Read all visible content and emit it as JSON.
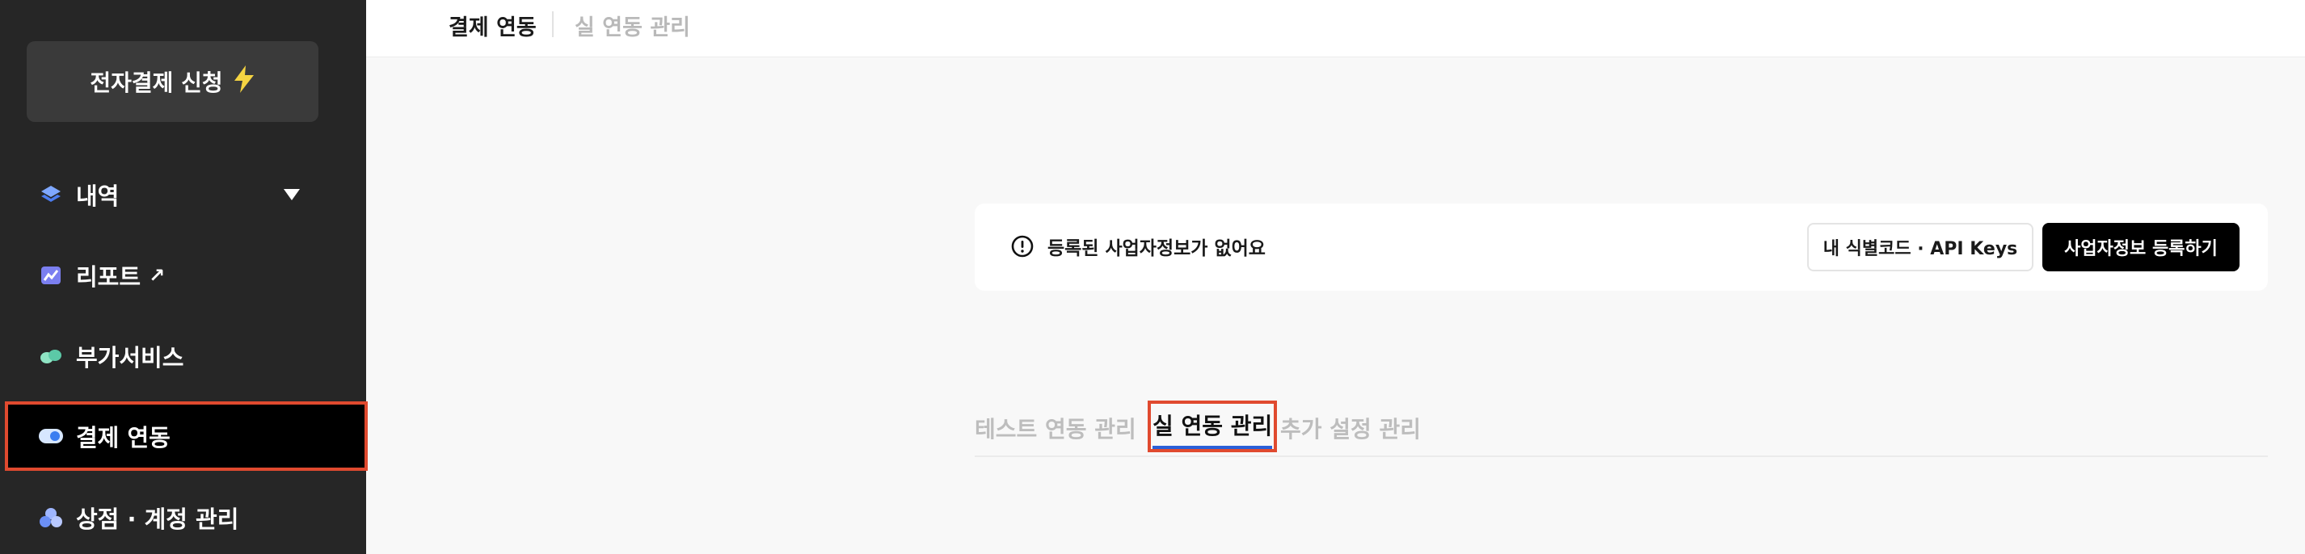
{
  "sidebar": {
    "apply_button": "전자결제 신청",
    "items": [
      {
        "label": "내역",
        "icon": "layers-icon"
      },
      {
        "label": "리포트",
        "icon": "chart-icon"
      },
      {
        "label": "부가서비스",
        "icon": "pills-icon"
      },
      {
        "label": "결제 연동",
        "icon": "toggle-icon"
      },
      {
        "label": "상점 · 계정 관리",
        "icon": "group-icon"
      }
    ]
  },
  "header": {
    "tab_active": "결제 연동",
    "tab_inactive": "실 연동 관리"
  },
  "notice": {
    "message": "등록된 사업자정보가 없어요",
    "keys_button": "내 식별코드 · API Keys",
    "register_button": "사업자정보 등록하기"
  },
  "subtabs": {
    "test": "테스트 연동 관리",
    "live": "실 연동 관리",
    "extra": "추가 설정 관리"
  },
  "colors": {
    "sidebar_bg": "#262626",
    "highlight": "#e04a2f",
    "active_underline": "#2a5fd8"
  }
}
